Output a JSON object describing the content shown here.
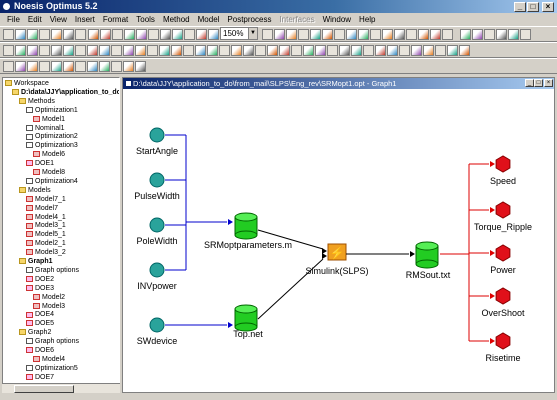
{
  "window": {
    "title": "Noesis Optimus 5.2",
    "minimize": "_",
    "maximize": "□",
    "close": "×"
  },
  "menu": [
    {
      "label": "File",
      "enabled": true
    },
    {
      "label": "Edit",
      "enabled": true
    },
    {
      "label": "View",
      "enabled": true
    },
    {
      "label": "Insert",
      "enabled": true
    },
    {
      "label": "Format",
      "enabled": true
    },
    {
      "label": "Tools",
      "enabled": true
    },
    {
      "label": "Method",
      "enabled": true
    },
    {
      "label": "Model",
      "enabled": true
    },
    {
      "label": "Postprocess",
      "enabled": true
    },
    {
      "label": "Interfaces",
      "enabled": false
    },
    {
      "label": "Window",
      "enabled": true
    },
    {
      "label": "Help",
      "enabled": true
    }
  ],
  "toolbar": {
    "zoom": "150%"
  },
  "tree": [
    {
      "label": "Workspace",
      "icon": "folder",
      "level": 0
    },
    {
      "label": "D:\\data\\JJY\\application_to_do",
      "icon": "folder",
      "level": 1,
      "bold": true
    },
    {
      "label": "Methods",
      "icon": "folder",
      "level": 2
    },
    {
      "label": "Optimization1",
      "icon": "opt",
      "level": 3
    },
    {
      "label": "Model1",
      "icon": "model",
      "level": 4
    },
    {
      "label": "Nominal1",
      "icon": "opt",
      "level": 3
    },
    {
      "label": "Optimization2",
      "icon": "opt",
      "level": 3
    },
    {
      "label": "Optimization3",
      "icon": "opt",
      "level": 3
    },
    {
      "label": "Model6",
      "icon": "model",
      "level": 4
    },
    {
      "label": "DOE1",
      "icon": "doe",
      "level": 3
    },
    {
      "label": "Model8",
      "icon": "model",
      "level": 4
    },
    {
      "label": "Optimization4",
      "icon": "opt",
      "level": 3
    },
    {
      "label": "Models",
      "icon": "folder",
      "level": 2
    },
    {
      "label": "Model7_1",
      "icon": "model",
      "level": 3
    },
    {
      "label": "Model7",
      "icon": "model",
      "level": 3
    },
    {
      "label": "Model4_1",
      "icon": "model",
      "level": 3
    },
    {
      "label": "Model3_1",
      "icon": "model",
      "level": 3
    },
    {
      "label": "Model5_1",
      "icon": "model",
      "level": 3
    },
    {
      "label": "Model2_1",
      "icon": "model",
      "level": 3
    },
    {
      "label": "Model3_2",
      "icon": "model",
      "level": 3
    },
    {
      "label": "Graph1",
      "icon": "folder",
      "level": 2,
      "bold": true
    },
    {
      "label": "Graph options",
      "icon": "opt",
      "level": 3
    },
    {
      "label": "DOE2",
      "icon": "doe",
      "level": 3
    },
    {
      "label": "DOE3",
      "icon": "doe",
      "level": 3
    },
    {
      "label": "Model2",
      "icon": "model",
      "level": 4
    },
    {
      "label": "Model3",
      "icon": "model",
      "level": 4
    },
    {
      "label": "DOE4",
      "icon": "doe",
      "level": 3
    },
    {
      "label": "DOE5",
      "icon": "doe",
      "level": 3
    },
    {
      "label": "Graph2",
      "icon": "folder",
      "level": 2
    },
    {
      "label": "Graph options",
      "icon": "opt",
      "level": 3
    },
    {
      "label": "DOE6",
      "icon": "doe",
      "level": 3
    },
    {
      "label": "Model4",
      "icon": "model",
      "level": 4
    },
    {
      "label": "Optimization5",
      "icon": "opt",
      "level": 3
    },
    {
      "label": "DOE7",
      "icon": "doe",
      "level": 3
    }
  ],
  "graph": {
    "title": "D:\\data\\JJY\\application_to_do\\from_mail\\SLPS\\Eng_rev\\SRMopt1.opt - Graph1",
    "inputs": [
      "StartAngle",
      "PulseWidth",
      "PoleWidth",
      "INVpower",
      "SWdevice"
    ],
    "datafiles": [
      "SRMoptparameters.m",
      "Top.net",
      "RMSout.txt"
    ],
    "simulator": "Simulink(SLPS)",
    "outputs": [
      "Speed",
      "Torque_Ripple",
      "Power",
      "OverShoot",
      "Risetime"
    ],
    "colors": {
      "input": "#2aa39b",
      "file": "#22cc22",
      "sim": "#f0a020",
      "output": "#e0101a",
      "blue_link": "#0000cc",
      "red_link": "#dd0000"
    }
  }
}
